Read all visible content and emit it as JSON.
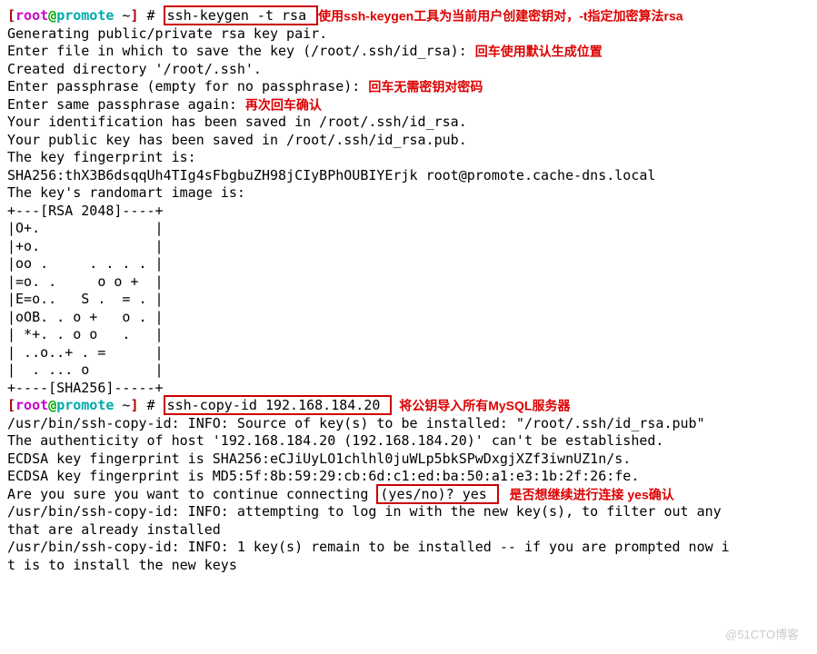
{
  "prompt1": {
    "lb": "[",
    "user": "root",
    "at": "@",
    "host": "promote",
    "path": " ~",
    "rb": "]",
    "hash": " # ",
    "cmd": "ssh-keygen -t rsa ",
    "note": "使用ssh-keygen工具为当前用户创建密钥对，-t指定加密算法rsa"
  },
  "l2": "Generating public/private rsa key pair.",
  "l3a": "Enter file in which to save the key (/root/.ssh/id_rsa): ",
  "l3note": "回车使用默认生成位置",
  "l4": "Created directory '/root/.ssh'.",
  "l5a": "Enter passphrase (empty for no passphrase): ",
  "l5note": "回车无需密钥对密码",
  "l6a": "Enter same passphrase again: ",
  "l6note": "再次回车确认",
  "l7": "Your identification has been saved in /root/.ssh/id_rsa.",
  "l8": "Your public key has been saved in /root/.ssh/id_rsa.pub.",
  "l9": "The key fingerprint is:",
  "l10": "SHA256:thX3B6dsqqUh4TIg4sFbgbuZH98jCIyBPhOUBIYErjk root@promote.cache-dns.local",
  "l11": "The key's randomart image is:",
  "art1": "+---[RSA 2048]----+",
  "art2": "|O+.              |",
  "art3": "|+o.              |",
  "art4": "|oo .     . . . . |",
  "art5": "|=o. .     o o +  |",
  "art6": "|E=o..   S .  = . |",
  "art7": "|oOB. . o +   o . |",
  "art8": "| *+. . o o   .   |",
  "art9": "| ..o..+ . =      |",
  "art10": "|  . ... o        |",
  "art11": "+----[SHA256]-----+",
  "prompt2": {
    "cmd": "ssh-copy-id 192.168.184.20 ",
    "note": "将公钥导入所有MySQL服务器"
  },
  "l20": "/usr/bin/ssh-copy-id: INFO: Source of key(s) to be installed: \"/root/.ssh/id_rsa.pub\"",
  "l21": "The authenticity of host '192.168.184.20 (192.168.184.20)' can't be established.",
  "l22": "ECDSA key fingerprint is SHA256:eCJiUyLO1chlhl0juWLp5bkSPwDxgjXZf3iwnUZ1n/s.",
  "l23": "ECDSA key fingerprint is MD5:5f:8b:59:29:cb:6d:c1:ed:ba:50:a1:e3:1b:2f:26:fe.",
  "l24a": "Are you sure you want to continue connecting ",
  "l24b": "(yes/no)? yes ",
  "l24note": "   是否想继续进行连接 yes确认",
  "l25": "/usr/bin/ssh-copy-id: INFO: attempting to log in with the new key(s), to filter out any ",
  "l26": "that are already installed",
  "l27": "/usr/bin/ssh-copy-id: INFO: 1 key(s) remain to be installed -- if you are prompted now i",
  "l28": "t is to install the new keys",
  "watermark": "@51CTO博客"
}
